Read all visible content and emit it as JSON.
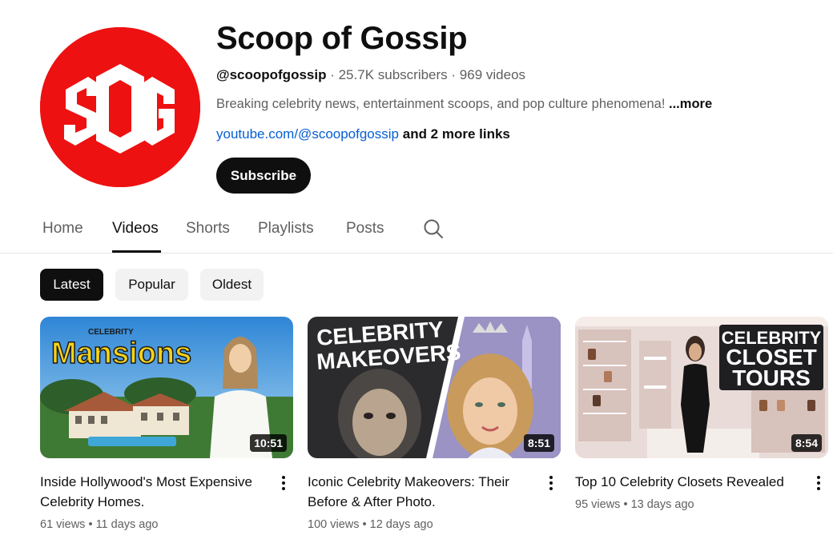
{
  "channel": {
    "avatar_text": "SOG",
    "title": "Scoop of Gossip",
    "handle": "@scoopofgossip",
    "subscribers": "· 25.7K subscribers",
    "videos": "· 969 videos",
    "description": "Breaking celebrity news, entertainment scoops, and pop culture phenomena!",
    "description_more": "...more",
    "link": "youtube.com/@scoopofgossip",
    "more_links": "and 2 more links",
    "subscribe_label": "Subscribe"
  },
  "tabs": [
    {
      "label": "Home",
      "active": false
    },
    {
      "label": "Videos",
      "active": true
    },
    {
      "label": "Shorts",
      "active": false
    },
    {
      "label": "Playlists",
      "active": false
    },
    {
      "label": "Posts",
      "active": false
    }
  ],
  "icons": {
    "search": "search-icon",
    "more": "more-vert-icon"
  },
  "chips": [
    {
      "label": "Latest",
      "active": true
    },
    {
      "label": "Popular",
      "active": false
    },
    {
      "label": "Oldest",
      "active": false
    }
  ],
  "videos": [
    {
      "title": "Inside Hollywood's Most Expensive Celebrity Homes.",
      "views": "61 views",
      "age": "11 days ago",
      "duration": "10:51",
      "thumb_text_small": "CELEBRITY",
      "thumb_text": "Mansions"
    },
    {
      "title": "Iconic Celebrity Makeovers: Their Before & After Photo.",
      "views": "100 views",
      "age": "12 days ago",
      "duration": "8:51",
      "thumb_text_line1": "CELEBRITY",
      "thumb_text_line2": "MAKEOVERS"
    },
    {
      "title": "Top 10 Celebrity Closets Revealed",
      "views": "95 views",
      "age": "13 days ago",
      "duration": "8:54",
      "thumb_text_line1": "CELEBRITY",
      "thumb_text_line2": "CLOSET",
      "thumb_text_line3": "TOURS"
    }
  ],
  "colors": {
    "brand_red": "#ee1111",
    "link_blue": "#065fd4",
    "text_primary": "#0f0f0f",
    "text_secondary": "#606060",
    "chip_bg": "#f2f2f2"
  }
}
